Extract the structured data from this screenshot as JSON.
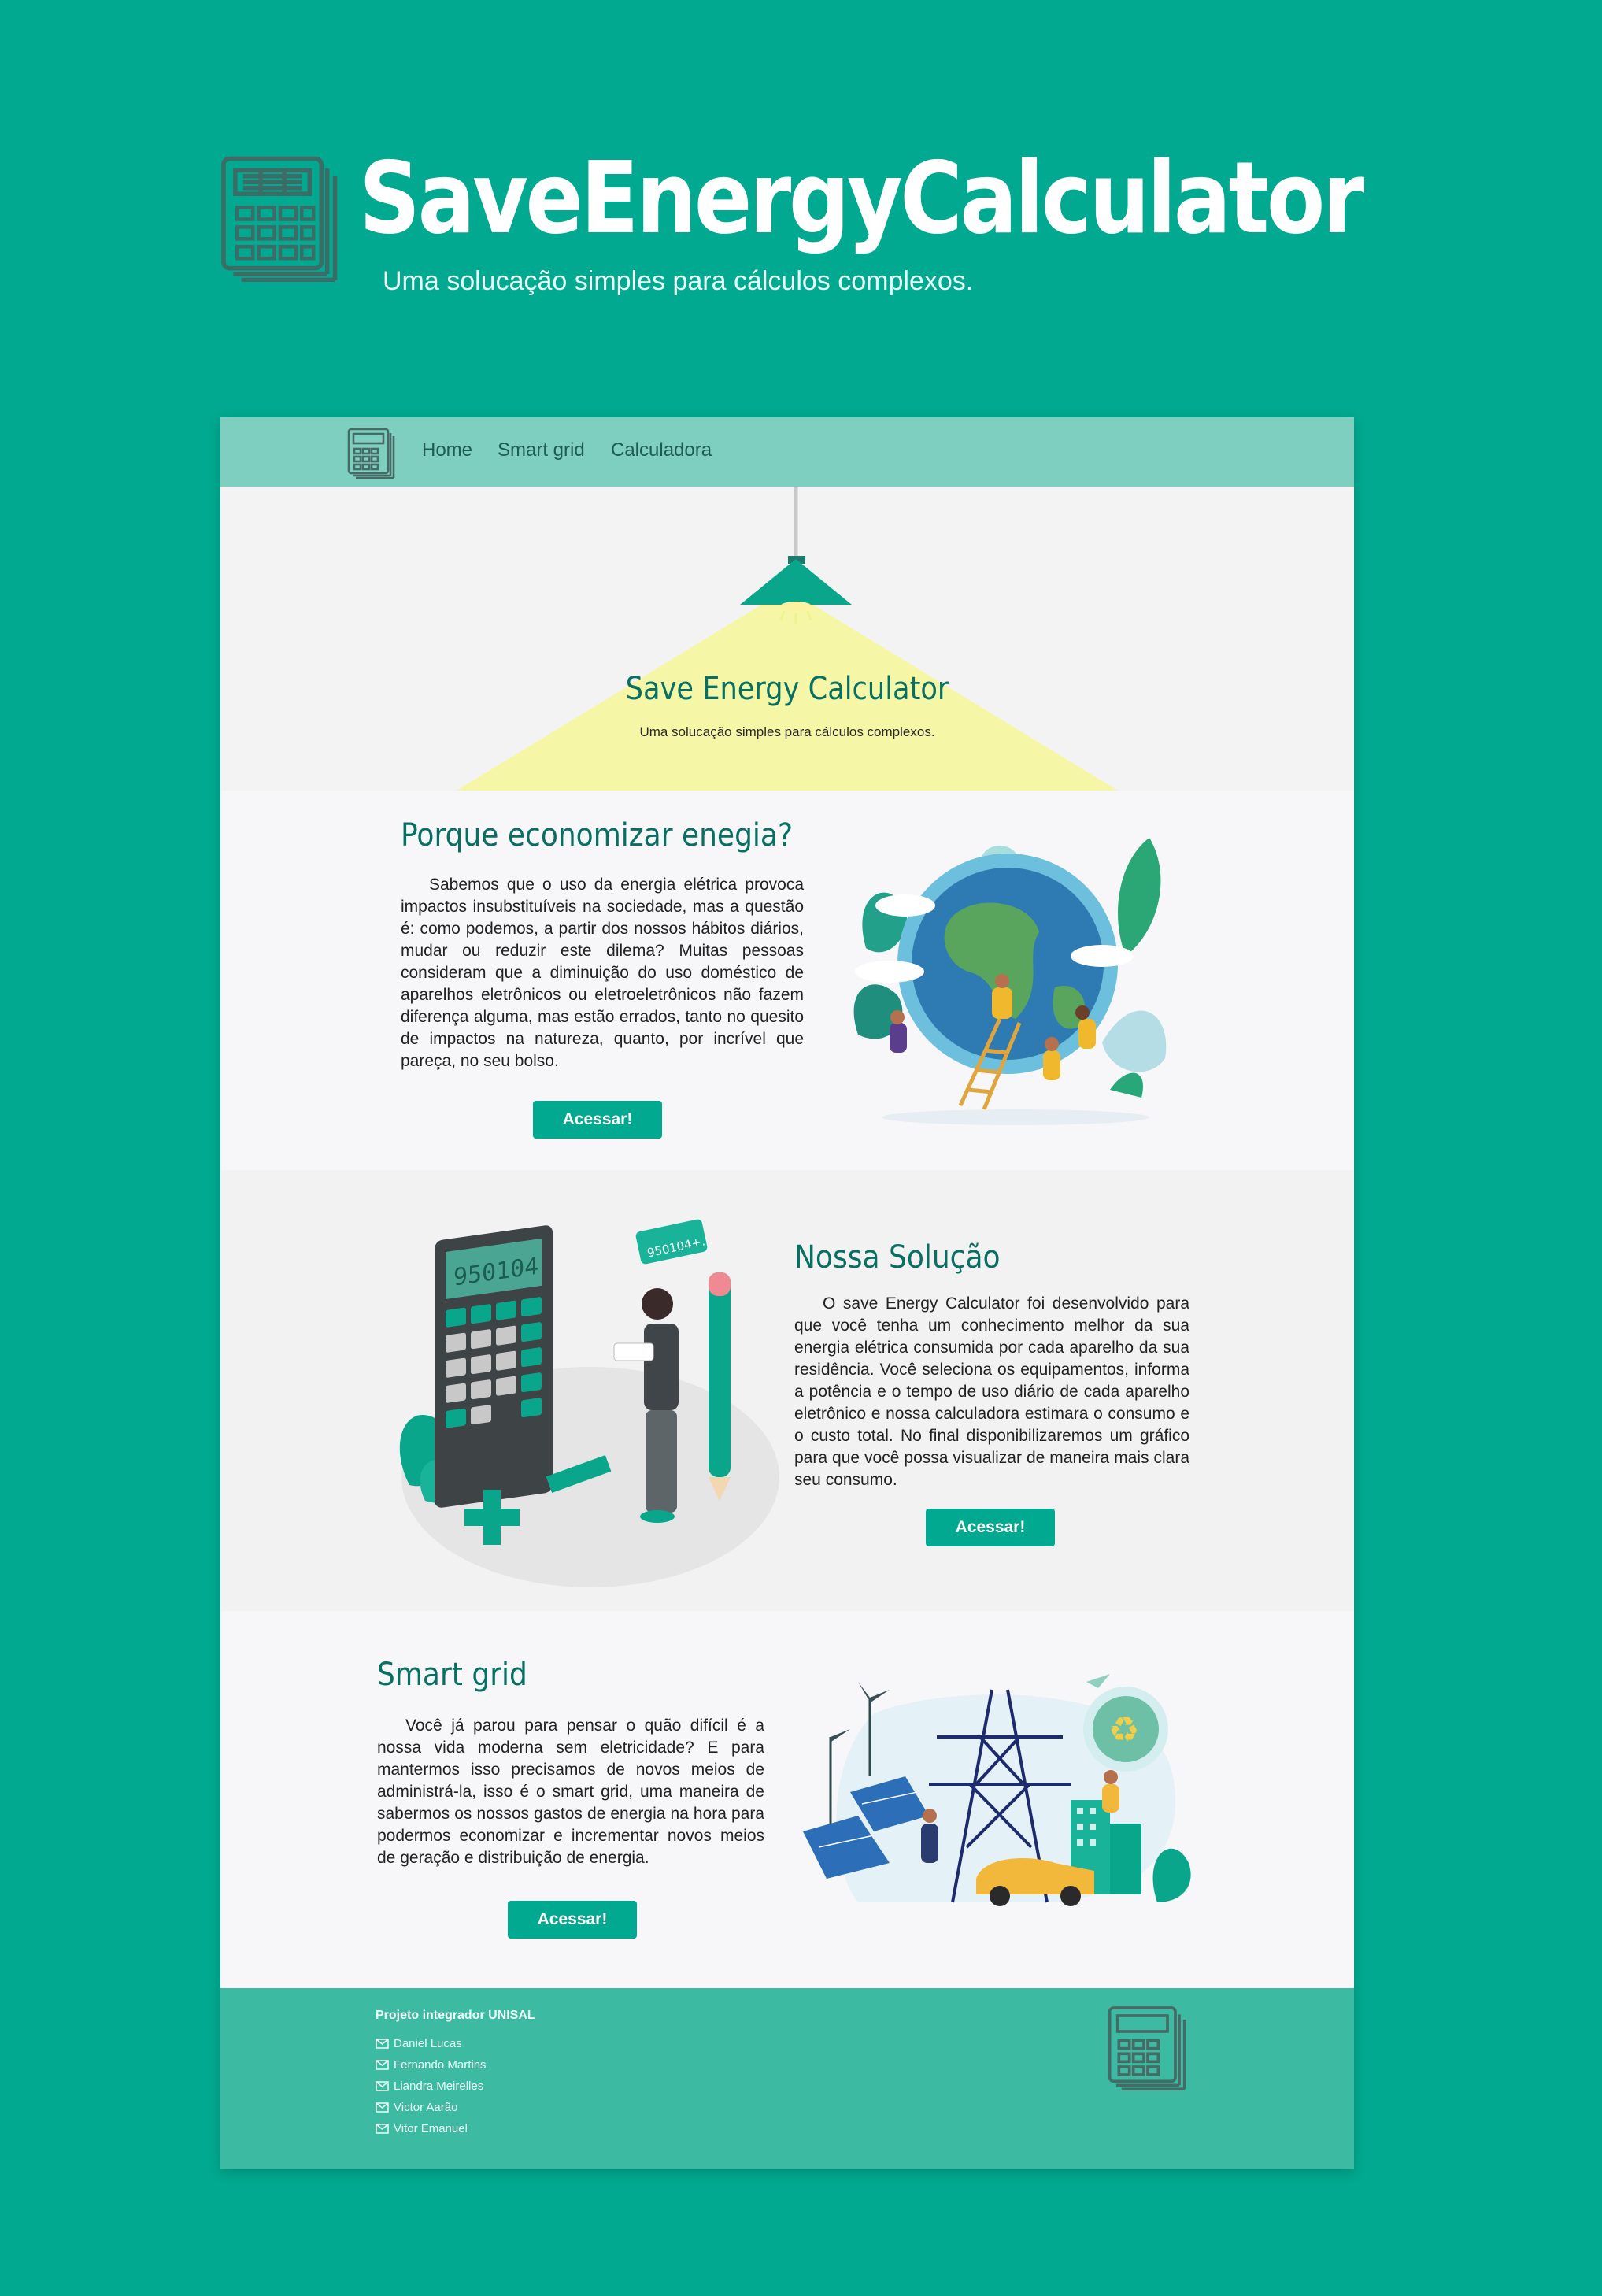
{
  "hero": {
    "title": "SaveEnergyCalculator",
    "subtitle": "Uma solucação simples para cálculos complexos.",
    "logo_icon": "calculator-icon"
  },
  "nav": {
    "logo_icon": "calculator-icon",
    "items": [
      "Home",
      "Smart grid",
      "Calculadora"
    ]
  },
  "banner": {
    "title": "Save Energy Calculator",
    "subtitle": "Uma solucação simples para cálculos complexos."
  },
  "sections": [
    {
      "title": "Porque economizar enegia?",
      "text": "Sabemos que o uso da energia elétrica provoca impactos insubstituíveis na sociedade, mas a questão é: como podemos, a partir dos nossos hábitos diários, mudar ou reduzir este dilema? Muitas pessoas consideram que a diminuição do uso doméstico de aparelhos eletrônicos ou eletroeletrônicos não fazem diferença alguma, mas estão errados, tanto no quesito de impactos na natureza, quanto, por incrível que pareça, no seu bolso.",
      "button": "Acessar!"
    },
    {
      "title": "Nossa Solução",
      "text": "O save Energy Calculator foi desenvolvido para que você tenha um conhecimento melhor da sua energia elétrica consumida por cada aparelho da sua residência. Você seleciona os equipamentos, informa a potência e o tempo de uso diário de cada aparelho eletrônico e nossa calculadora estimara o consumo e o custo total. No final disponibilizaremos um gráfico para que você possa visualizar de maneira mais clara seu consumo.",
      "button": "Acessar!",
      "calc_display": "950104",
      "bubble_text": "950104+..."
    },
    {
      "title": "Smart grid",
      "text": "Você já parou para pensar o quão difícil é a nossa vida moderna sem eletricidade? E para mantermos isso precisamos de novos meios de administrá-la, isso é o smart grid, uma maneira de sabermos os nossos gastos de energia na hora para podermos economizar e incrementar novos meios de geração e distribuição de energia.",
      "button": "Acessar!"
    }
  ],
  "footer": {
    "title": "Projeto integrador UNISAL",
    "members": [
      "Daniel Lucas",
      "Fernando Martins",
      "Liandra Meirelles",
      "Victor Aarão",
      "Vitor Emanuel"
    ],
    "member_icon": "mail-icon",
    "logo_icon": "calculator-icon"
  },
  "colors": {
    "page_background": "#00a98f",
    "nav_background": "#7ecfc0",
    "accent": "#087062",
    "button": "#00a98f",
    "footer_background": "#3dbba2",
    "light_cone": "#f6f7a6"
  }
}
